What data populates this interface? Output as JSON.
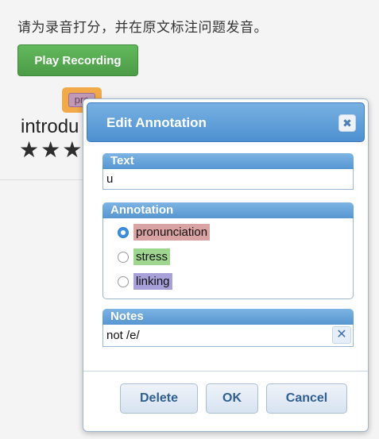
{
  "page": {
    "instruction": "请为录音打分，并在原文标注问题发音。",
    "play_button": "Play Recording",
    "tag_text": "pro",
    "word_text": "introdu",
    "stars": [
      "★",
      "★",
      "★"
    ]
  },
  "dialog": {
    "title": "Edit Annotation",
    "close_symbol": "✖",
    "text_section": {
      "label": "Text",
      "value": "u"
    },
    "annotation_section": {
      "label": "Annotation",
      "options": [
        {
          "label": "pronunciation",
          "selected": true,
          "color": "#d9a3a3"
        },
        {
          "label": "stress",
          "selected": false,
          "color": "#9fd68f"
        },
        {
          "label": "linking",
          "selected": false,
          "color": "#a8a0d8"
        }
      ]
    },
    "notes_section": {
      "label": "Notes",
      "value": "not /e/",
      "clear_symbol": "✕"
    },
    "buttons": {
      "delete": "Delete",
      "ok": "OK",
      "cancel": "Cancel"
    }
  },
  "colors": {
    "accent_blue": "#5a9ad6",
    "play_green": "#56aa50",
    "tag_orange": "#f1a94a"
  }
}
